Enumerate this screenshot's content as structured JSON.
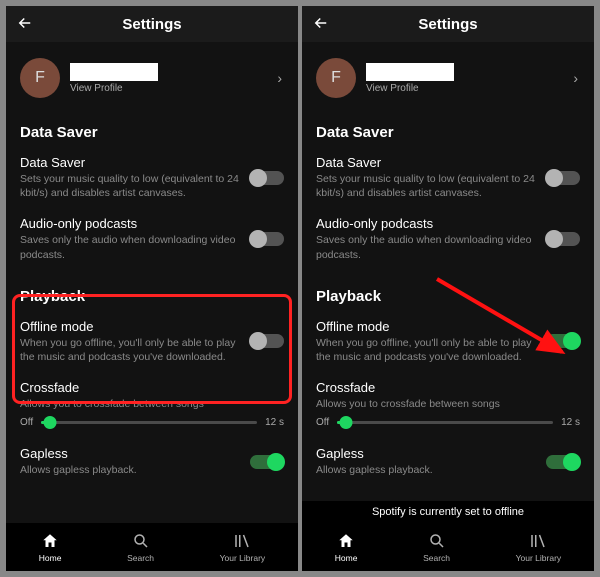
{
  "header": {
    "title": "Settings"
  },
  "profile": {
    "initial": "F",
    "view": "View Profile"
  },
  "sections": {
    "data_saver_h": "Data Saver",
    "playback_h": "Playback"
  },
  "rows": {
    "data_saver": {
      "title": "Data Saver",
      "desc": "Sets your music quality to low (equivalent to 24 kbit/s) and disables artist canvases."
    },
    "audio_only": {
      "title": "Audio-only podcasts",
      "desc": "Saves only the audio when downloading video podcasts."
    },
    "offline": {
      "title": "Offline mode",
      "desc": "When you go offline, you'll only be able to play the music and podcasts you've downloaded."
    },
    "crossfade": {
      "title": "Crossfade",
      "desc": "Allows you to crossfade between songs"
    },
    "gapless": {
      "title": "Gapless",
      "desc": "Allows gapless playback."
    }
  },
  "slider": {
    "off": "Off",
    "max": "12 s"
  },
  "nav": {
    "home": "Home",
    "search": "Search",
    "library": "Your Library"
  },
  "toast": "Spotify is currently set to offline"
}
